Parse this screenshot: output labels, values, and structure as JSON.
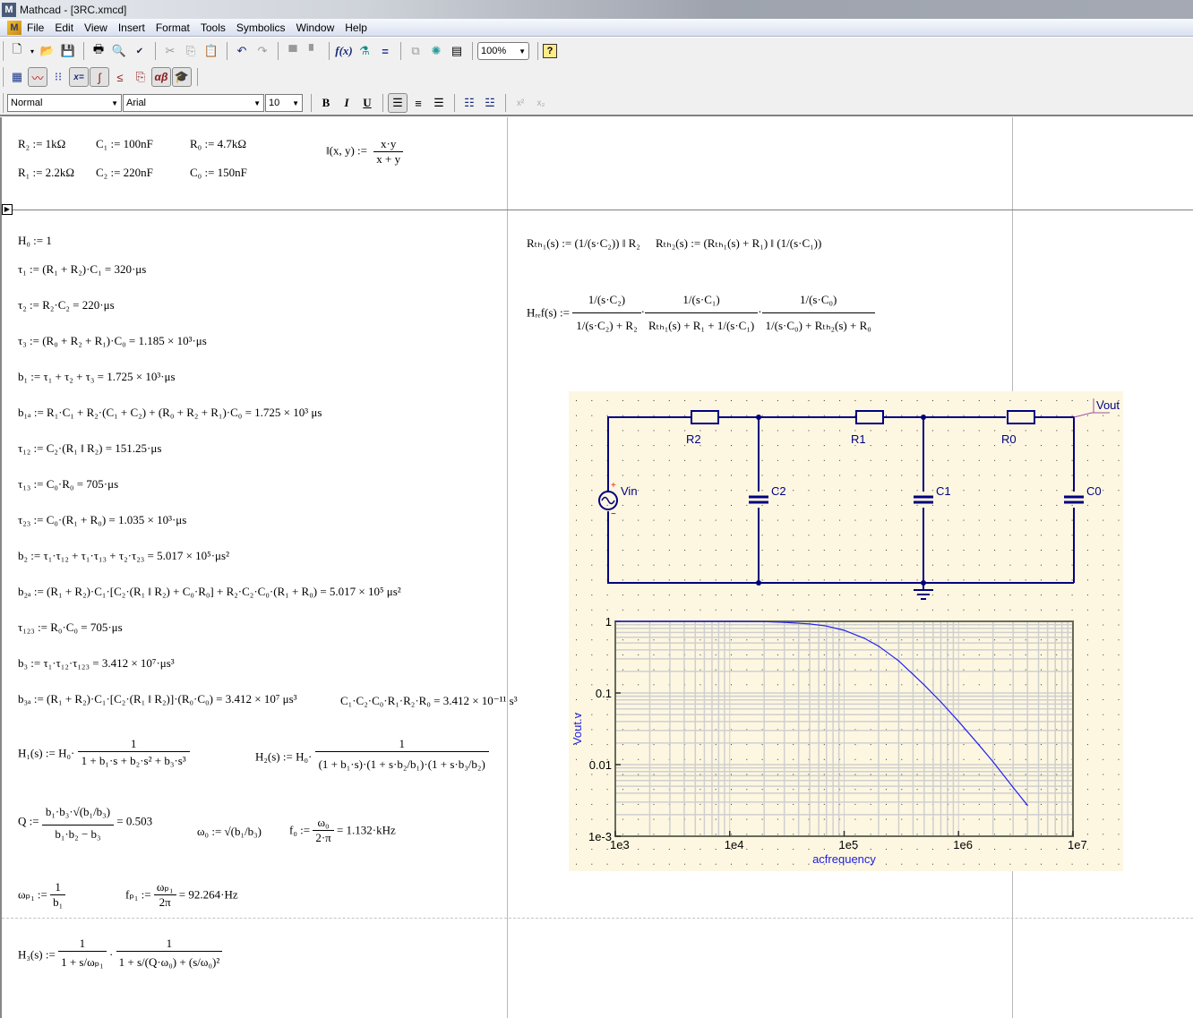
{
  "window": {
    "title": "Mathcad - [3RC.xmcd]"
  },
  "menu": [
    "File",
    "Edit",
    "View",
    "Insert",
    "Format",
    "Tools",
    "Symbolics",
    "Window",
    "Help"
  ],
  "toolbar": {
    "standard_icons": [
      "new-document",
      "new-dropdown",
      "open",
      "save",
      "print",
      "print-preview",
      "spell-check",
      "cut",
      "copy",
      "paste",
      "undo",
      "redo",
      "align-across",
      "align-down",
      "insert-function",
      "insert-unit",
      "calculate",
      "component",
      "resource-center",
      "insert-table",
      "zoom",
      "help"
    ],
    "zoom_value": "100%",
    "math_icons": [
      "calculator",
      "graph",
      "matrix",
      "evaluation",
      "calculus",
      "boolean",
      "programming",
      "greek",
      "symbolic"
    ],
    "style_value": "Normal",
    "font_value": "Arial",
    "size_value": "10",
    "format_buttons": {
      "bold": "B",
      "italic": "I",
      "underline": "U",
      "superscript": "x²",
      "subscript": "x₂"
    }
  },
  "definitions": {
    "r2": "R₂ := 1kΩ",
    "c1": "C₁ := 100nF",
    "r0": "R₀ := 4.7kΩ",
    "r1": "R₁ := 2.2kΩ",
    "c2": "C₂ := 220nF",
    "c0": "C₀ := 150nF",
    "parallel_lhs": "‖(x, y) :=",
    "parallel_num": "x·y",
    "parallel_den": "x + y"
  },
  "equations": [
    "H₀ := 1",
    "τ₁ := (R₁ + R₂)·C₁ = 320·μs",
    "τ₂ := R₂·C₂ = 220·μs",
    "τ₃ := (R₀ + R₂ + R₁)·C₀ = 1.185 × 10³·μs",
    "b₁ := τ₁ + τ₂ + τ₃ = 1.725 × 10³·μs",
    "b₁ₐ := R₁·C₁ + R₂·(C₁ + C₂) + (R₀ + R₂ + R₁)·C₀ = 1.725 × 10³ μs",
    "τ₁₂ := C₂·(R₁ ‖ R₂) = 151.25·μs",
    "τ₁₃ := C₀·R₀ = 705·μs",
    "τ₂₃ := C₀·(R₁ + R₀) = 1.035 × 10³·μs",
    "b₂ := τ₁·τ₁₂ + τ₁·τ₁₃ + τ₂·τ₂₃ = 5.017 × 10⁵·μs²",
    "b₂ₐ := (R₁ + R₂)·C₁·[C₂·(R₁ ‖ R₂) + C₀·R₀] + R₂·C₂·C₀·(R₁ + R₀) = 5.017 × 10⁵ μs²",
    "τ₁₂₃ := R₀·C₀ = 705·μs",
    "b₃ := τ₁·τ₁₂·τ₁₂₃ = 3.412 × 10⁷·μs³",
    "b₃ₐ := (R₁ + R₂)·C₁·[C₂·(R₁ ‖ R₂)]·(R₀·C₀) = 3.412 × 10⁷ μs³"
  ],
  "product_check": "C₁·C₂·C₀·R₁·R₂·R₀ = 3.412 × 10⁻¹¹ s³",
  "h1": {
    "lhs": "H₁(s) := H₀·",
    "num": "1",
    "den": "1 + b₁·s + b₂·s² + b₃·s³"
  },
  "h2": {
    "lhs": "H₂(s) := H₀·",
    "num": "1",
    "den": "(1 + b₁·s)·(1 + s·b₂/b₁)·(1 + s·b₃/b₂)"
  },
  "q": {
    "lhs": "Q :=",
    "num": "b₁·b₃·√(b₁/b₃)",
    "den": "b₁·b₂ − b₃",
    "result": "= 0.503"
  },
  "w0": {
    "lhs": "ω₀ :=",
    "expr": "√(b₁/b₃)"
  },
  "f0": {
    "lhs": "f₀ :=",
    "num": "ω₀",
    "den": "2·π",
    "result": "= 1.132·kHz"
  },
  "wp1": {
    "lhs": "ωₚ₁ :=",
    "num": "1",
    "den": "b₁"
  },
  "fp1": {
    "lhs": "fₚ₁ :=",
    "num": "ωₚ₁",
    "den": "2π",
    "result": "= 92.264·Hz"
  },
  "h3": {
    "lhs": "H₃(s) :=",
    "num1": "1",
    "den1": "1 + s/ωₚ₁",
    "num2": "1",
    "den2": "1 + s/(Q·ω₀) + (s/ω₀)²"
  },
  "rth1": {
    "lhs": "Rₜₕ₁(s) :=",
    "expr": "(1/(s·C₂)) ‖ R₂"
  },
  "rth2": {
    "lhs": "Rₜₕ₂(s) :=",
    "expr": "(Rₜₕ₁(s) + R₁) ‖ (1/(s·C₁))"
  },
  "href": {
    "lhs": "Hᵣₑf(s) :=",
    "f1num": "1/(s·C₂)",
    "f1den": "1/(s·C₂) + R₂",
    "f2num": "1/(s·C₁)",
    "f2den": "Rₜₕ₁(s) + R₁ + 1/(s·C₁)",
    "f3num": "1/(s·C₀)",
    "f3den": "1/(s·C₀) + Rₜₕ₂(s) + R₀"
  },
  "schematic": {
    "labels": {
      "source": "Vin",
      "r2": "R2",
      "r1": "R1",
      "r0": "R0",
      "c2": "C2",
      "c1": "C1",
      "c0": "C0",
      "out": "Vout"
    },
    "wire_color": "#00007f",
    "background": "#fdf7e1"
  },
  "chart_data": {
    "type": "line",
    "title": "",
    "xlabel": "acfrequency",
    "ylabel": "Vout.v",
    "xscale": "log",
    "yscale": "log",
    "xlim": [
      1000,
      10000000
    ],
    "ylim": [
      0.001,
      1
    ],
    "xticks": [
      "1e3",
      "1e4",
      "1e5",
      "1e6",
      "1e7"
    ],
    "yticks": [
      "1",
      "0.1",
      "0.01",
      "1e-3"
    ],
    "grid": true,
    "series": [
      {
        "name": "Vout.v",
        "color": "#2222ee",
        "x": [
          1000,
          5000,
          10000,
          20000,
          30000,
          50000,
          70000,
          100000,
          150000,
          200000,
          300000,
          500000,
          700000,
          1000000,
          1500000,
          2000000,
          3000000,
          4000000
        ],
        "y": [
          1,
          1,
          1,
          0.99,
          0.97,
          0.92,
          0.86,
          0.75,
          0.58,
          0.45,
          0.28,
          0.13,
          0.075,
          0.04,
          0.019,
          0.011,
          0.0048,
          0.0027
        ]
      }
    ]
  }
}
